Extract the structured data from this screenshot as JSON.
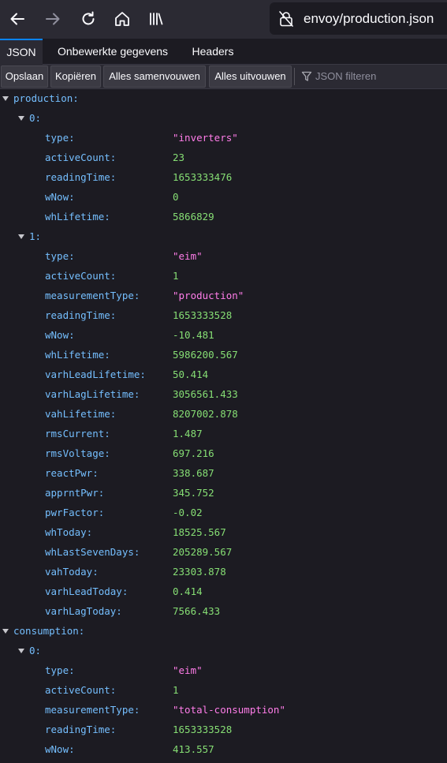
{
  "browser": {
    "url": "envoy/production.json"
  },
  "viewer_tabs": [
    {
      "label": "JSON"
    },
    {
      "label": "Onbewerkte gegevens"
    },
    {
      "label": "Headers"
    }
  ],
  "toolbar": {
    "save_label": "Opslaan",
    "copy_label": "Kopiëren",
    "collapse_label": "Alles samenvouwen",
    "expand_label": "Alles uitvouwen",
    "filter_placeholder": "JSON filteren"
  },
  "json": {
    "production": {
      "key": "production:",
      "items": [
        {
          "index": "0:",
          "fields": [
            {
              "key": "type:",
              "value": "\"inverters\"",
              "kind": "string"
            },
            {
              "key": "activeCount:",
              "value": "23",
              "kind": "number"
            },
            {
              "key": "readingTime:",
              "value": "1653333476",
              "kind": "number"
            },
            {
              "key": "wNow:",
              "value": "0",
              "kind": "number"
            },
            {
              "key": "whLifetime:",
              "value": "5866829",
              "kind": "number"
            }
          ]
        },
        {
          "index": "1:",
          "fields": [
            {
              "key": "type:",
              "value": "\"eim\"",
              "kind": "string"
            },
            {
              "key": "activeCount:",
              "value": "1",
              "kind": "number"
            },
            {
              "key": "measurementType:",
              "value": "\"production\"",
              "kind": "string"
            },
            {
              "key": "readingTime:",
              "value": "1653333528",
              "kind": "number"
            },
            {
              "key": "wNow:",
              "value": "-10.481",
              "kind": "number"
            },
            {
              "key": "whLifetime:",
              "value": "5986200.567",
              "kind": "number"
            },
            {
              "key": "varhLeadLifetime:",
              "value": "50.414",
              "kind": "number"
            },
            {
              "key": "varhLagLifetime:",
              "value": "3056561.433",
              "kind": "number"
            },
            {
              "key": "vahLifetime:",
              "value": "8207002.878",
              "kind": "number"
            },
            {
              "key": "rmsCurrent:",
              "value": "1.487",
              "kind": "number"
            },
            {
              "key": "rmsVoltage:",
              "value": "697.216",
              "kind": "number"
            },
            {
              "key": "reactPwr:",
              "value": "338.687",
              "kind": "number"
            },
            {
              "key": "apprntPwr:",
              "value": "345.752",
              "kind": "number"
            },
            {
              "key": "pwrFactor:",
              "value": "-0.02",
              "kind": "number"
            },
            {
              "key": "whToday:",
              "value": "18525.567",
              "kind": "number"
            },
            {
              "key": "whLastSevenDays:",
              "value": "205289.567",
              "kind": "number"
            },
            {
              "key": "vahToday:",
              "value": "23303.878",
              "kind": "number"
            },
            {
              "key": "varhLeadToday:",
              "value": "0.414",
              "kind": "number"
            },
            {
              "key": "varhLagToday:",
              "value": "7566.433",
              "kind": "number"
            }
          ]
        }
      ]
    },
    "consumption": {
      "key": "consumption:",
      "items": [
        {
          "index": "0:",
          "fields": [
            {
              "key": "type:",
              "value": "\"eim\"",
              "kind": "string"
            },
            {
              "key": "activeCount:",
              "value": "1",
              "kind": "number"
            },
            {
              "key": "measurementType:",
              "value": "\"total-consumption\"",
              "kind": "string"
            },
            {
              "key": "readingTime:",
              "value": "1653333528",
              "kind": "number"
            },
            {
              "key": "wNow:",
              "value": "413.557",
              "kind": "number"
            }
          ]
        }
      ]
    }
  }
}
